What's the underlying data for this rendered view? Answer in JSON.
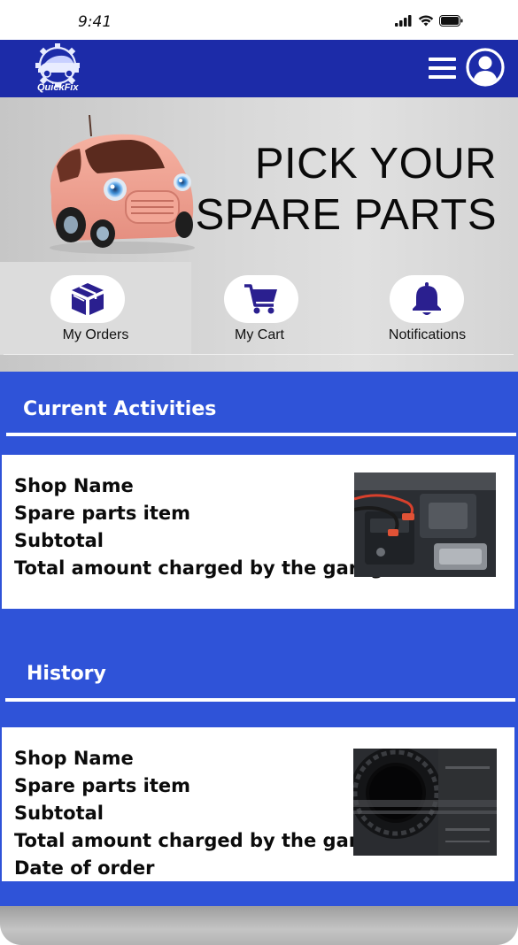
{
  "status_bar": {
    "time": "9:41"
  },
  "header": {
    "logo_text": "QuickFix"
  },
  "hero": {
    "title_line1": "PICK YOUR",
    "title_line2": "SPARE PARTS"
  },
  "quick_nav": {
    "items": [
      {
        "label": "My Orders",
        "icon": "box-icon",
        "active": true
      },
      {
        "label": "My Cart",
        "icon": "cart-icon",
        "active": false
      },
      {
        "label": "Notifications",
        "icon": "bell-icon",
        "active": false
      }
    ]
  },
  "current": {
    "title": "Current Activities",
    "lines": [
      "Shop Name",
      "Spare parts item",
      "Subtotal",
      "Total amount charged by the garage"
    ],
    "image": "engine-bay-jumper-cables-photo"
  },
  "history": {
    "title": "History",
    "lines": [
      "Shop Name",
      "Spare parts item",
      "Subtotal",
      "Total amount charged by the garage",
      "Date of order"
    ],
    "image": "tire-photo"
  },
  "colors": {
    "header": "#1c2ba8",
    "content": "#2f53d8",
    "nav_icon": "#2a1f8f"
  }
}
